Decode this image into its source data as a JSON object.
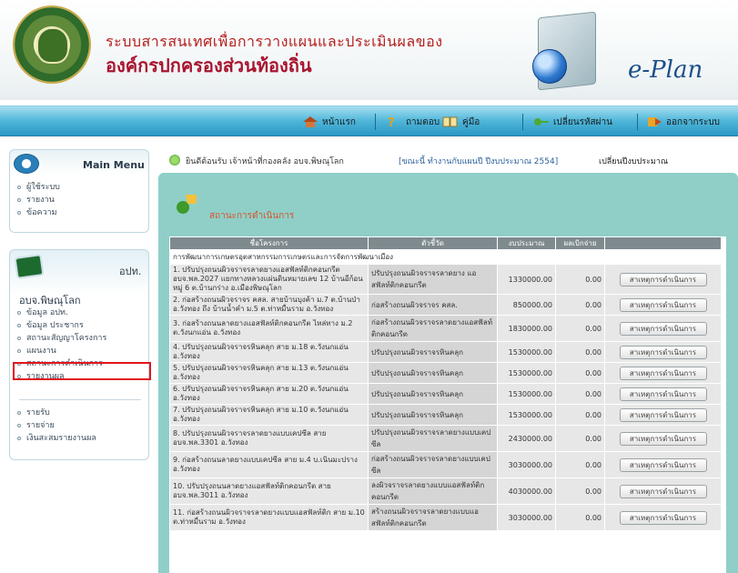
{
  "header": {
    "title_line1": "ระบบสารสนเทศเพื่อการวางแผนและประเมินผลของ",
    "title_line2": "องค์กรปกครองส่วนท้องถิ่น",
    "brand": "e-Plan"
  },
  "nav": {
    "items": [
      {
        "label": "หน้าแรก",
        "icon": "home-icon"
      },
      {
        "label": "ถามตอบ",
        "icon": "help-icon"
      },
      {
        "label": "คู่มือ",
        "icon": "manual-icon"
      },
      {
        "label": "เปลี่ยนรหัสผ่าน",
        "icon": "key-icon"
      },
      {
        "label": "ออกจากระบบ",
        "icon": "logout-icon"
      }
    ]
  },
  "sidebar": {
    "main_menu_title": "Main Menu",
    "main_menu_items": [
      "ผู้ใช้ระบบ",
      "รายงาน",
      "ข้อความ"
    ],
    "org_label": "อปท.",
    "org_name": "อบจ.พิษณุโลก",
    "org_items": [
      "ข้อมูล อปท.",
      "ข้อมูล ประชากร",
      "สถานะสัญญาโครงการ",
      "แผนงาน",
      "สถานะการดำเนินการ",
      "รายงานผล"
    ],
    "other_items": [
      "รายรับ",
      "รายจ่าย",
      "เงินสะสมรายงานผล"
    ]
  },
  "topinfo": {
    "user_text": "ยินดีต้อนรับ เจ้าหน้าที่กองคลัง อบจ.พิษณุโลก",
    "status_text": "[ขณะนี้ ทำงานกับแผนปี ปีงบประมาณ 2554]",
    "change_link": "เปลี่ยนปีงบประมาณ"
  },
  "content": {
    "title": "สถานะการดำเนินการ",
    "columns": [
      "ชื่อโครงการ",
      "ตัวชี้วัด",
      "งบประมาณ",
      "ผลเบิกจ่าย",
      ""
    ],
    "section_label": "การพัฒนาการเกษตรอุตสาหกรรมการเกษตรและการจัดการพัฒนาเมือง",
    "button_label": "สาเหตุการดำเนินการ",
    "rows": [
      {
        "project": "1. ปรับปรุงถนนผิวจราจรลาดยางแอสฟัลท์ติกคอนกรีต อบจ.พล.2027 แยกทางหลวงแผ่นดินหมายเลข 12 บ้านอีก้อน หมู่ 6 ต.บ้านกร่าง อ.เมืองพิษณุโลก",
        "indicator": "ปรับปรุงถนนผิวจราจรลาดยาง แอสฟัลท์ติกคอนกรีต",
        "budget": "1330000.00",
        "paid": "0.00"
      },
      {
        "project": "2. ก่อสร้างถนนผิวจราจร คสล. สายบ้านบุงค้า ม.7 ต.บ้านป่า อ.วังทอง ถึง บ้านน้ำคำ ม.5 ต.ท่าหมื่นราม อ.วังทอง",
        "indicator": "ก่อสร้างถนนผิวจราจร คสล.",
        "budget": "850000.00",
        "paid": "0.00"
      },
      {
        "project": "3. ก่อสร้างถนนลาดยางแอสฟัลท์ติกคอนกรีต ไหล่ทาง ม.2 ต.วังนกแอ่น อ.วังทอง",
        "indicator": "ก่อสร้างถนนผิวจราจรลาดยางแอสฟัลท์ติกคอนกรีต",
        "budget": "1830000.00",
        "paid": "0.00"
      },
      {
        "project": "4. ปรับปรุงถนนผิวจราจรหินคลุก สาย ม.18 ต.วังนกแอ่น อ.วังทอง",
        "indicator": "ปรับปรุงถนนผิวจราจรหินคลุก",
        "budget": "1530000.00",
        "paid": "0.00"
      },
      {
        "project": "5. ปรับปรุงถนนผิวจราจรหินคลุก สาย ม.13 ต.วังนกแอ่น อ.วังทอง",
        "indicator": "ปรับปรุงถนนผิวจราจรหินคลุก",
        "budget": "1530000.00",
        "paid": "0.00"
      },
      {
        "project": "6. ปรับปรุงถนนผิวจราจรหินคลุก สาย ม.20 ต.วังนกแอ่น อ.วังทอง",
        "indicator": "ปรับปรุงถนนผิวจราจรหินคลุก",
        "budget": "1530000.00",
        "paid": "0.00"
      },
      {
        "project": "7. ปรับปรุงถนนผิวจราจรหินคลุก สาย ม.10 ต.วังนกแอ่น อ.วังทอง",
        "indicator": "ปรับปรุงถนนผิวจราจรหินคลุก",
        "budget": "1530000.00",
        "paid": "0.00"
      },
      {
        "project": "8. ปรับปรุงถนนผิวจราจรลาดยางแบบเคปซีล สาย อบจ.พล.3301 อ.วังทอง",
        "indicator": "ปรับปรุงถนนผิวจราจรลาดยางแบบเคปซีล",
        "budget": "2430000.00",
        "paid": "0.00"
      },
      {
        "project": "9. ก่อสร้างถนนลาดยางแบบเคปซีล สาย ม.4 บ.เนินมะปราง อ.วังทอง",
        "indicator": "ก่อสร้างถนนผิวจราจรลาดยางแบบเคปซีล",
        "budget": "3030000.00",
        "paid": "0.00"
      },
      {
        "project": "10. ปรับปรุงถนนลาดยางแอสฟัลท์ติกคอนกรีต สาย อบจ.พล.3011 อ.วังทอง",
        "indicator": "ลงผิวจราจรลาดยางแบบแอสฟัลท์ติกคอนกรีต",
        "budget": "4030000.00",
        "paid": "0.00"
      },
      {
        "project": "11. ก่อสร้างถนนผิวจราจรลาดยางแบบแอสฟัลท์ติก สาย ม.10 ต.ท่าหมื่นราม อ.วังทอง",
        "indicator": "สร้างถนนผิวจราจรลาดยางแบบแอสฟัลท์ติกคอนกรีต",
        "budget": "3030000.00",
        "paid": "0.00"
      }
    ]
  }
}
